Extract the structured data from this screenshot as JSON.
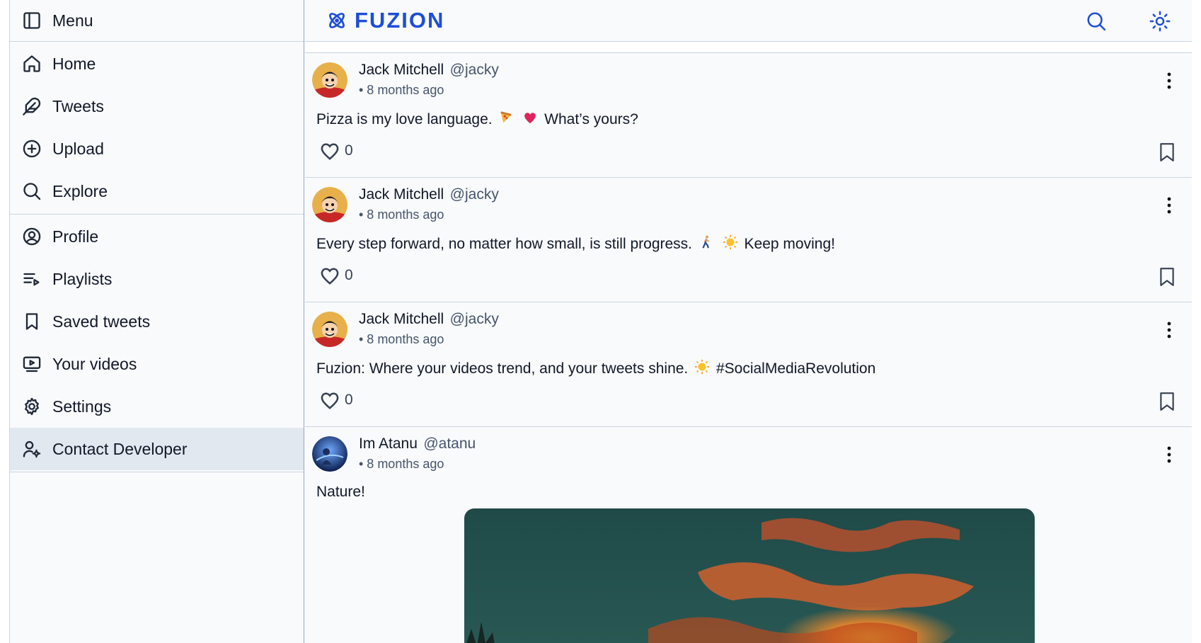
{
  "sidebar": {
    "menu_label": "Menu",
    "primary": [
      {
        "label": "Home",
        "icon": "home-icon"
      },
      {
        "label": "Tweets",
        "icon": "feather-icon"
      },
      {
        "label": "Upload",
        "icon": "plus-circle-icon"
      },
      {
        "label": "Explore",
        "icon": "search-icon"
      }
    ],
    "secondary": [
      {
        "label": "Profile",
        "icon": "user-circle-icon"
      },
      {
        "label": "Playlists",
        "icon": "playlist-icon"
      },
      {
        "label": "Saved tweets",
        "icon": "bookmark-icon"
      },
      {
        "label": "Your videos",
        "icon": "video-icon"
      },
      {
        "label": "Settings",
        "icon": "gear-icon"
      },
      {
        "label": "Contact Developer",
        "icon": "user-gear-icon",
        "active": true
      }
    ]
  },
  "header": {
    "logo_text": "FUZION",
    "accent_color": "#1d4ed8"
  },
  "posts": [
    {
      "name": "Jack Mitchell",
      "handle": "@jacky",
      "time": "• 8 months ago",
      "text_before": "Pizza is my love language.",
      "text_after": "What’s yours?",
      "emojis": [
        "pizza",
        "red-heart"
      ],
      "likes": "0"
    },
    {
      "name": "Jack Mitchell",
      "handle": "@jacky",
      "time": "• 8 months ago",
      "text_before": "Every step forward, no matter how small, is still progress.",
      "text_after": "Keep moving!",
      "emojis": [
        "person-walking",
        "sun"
      ],
      "likes": "0"
    },
    {
      "name": "Jack Mitchell",
      "handle": "@jacky",
      "time": "• 8 months ago",
      "text_before": "Fuzion: Where your videos trend, and your tweets shine.",
      "text_after": "#SocialMediaRevolution",
      "emojis": [
        "sun"
      ],
      "likes": "0"
    },
    {
      "name": "Im Atanu",
      "handle": "@atanu",
      "time": "• 8 months ago",
      "text_before": "Nature!",
      "text_after": "",
      "emojis": [],
      "has_image": true
    }
  ]
}
